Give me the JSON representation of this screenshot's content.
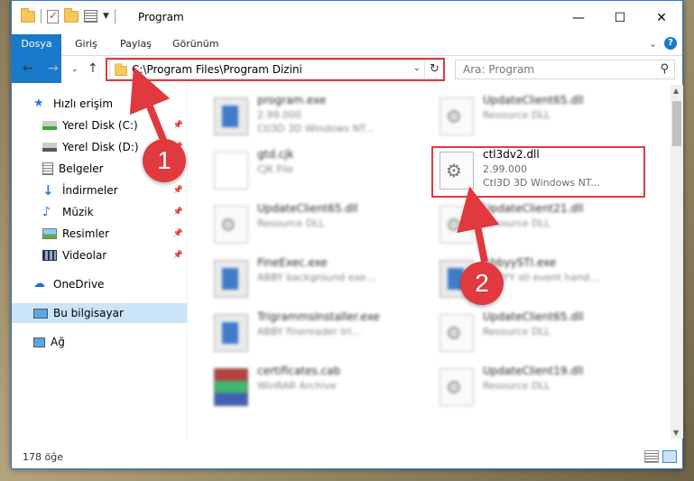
{
  "window": {
    "title": "Program",
    "controls": {
      "minimize": "—",
      "maximize": "☐",
      "close": "✕"
    }
  },
  "ribbon": {
    "tabs": [
      "Dosya",
      "Giriş",
      "Paylaş",
      "Görünüm"
    ],
    "help": "?"
  },
  "nav": {
    "address": "C:\\Program Files\\Program Dizini",
    "search_placeholder": "Ara: Program"
  },
  "sidebar": {
    "items": [
      {
        "label": "Hızlı erişim",
        "icon": "star-icon"
      },
      {
        "label": "Yerel Disk (C:)",
        "icon": "drive-icon"
      },
      {
        "label": "Yerel Disk (D:)",
        "icon": "drive-icon"
      },
      {
        "label": "Belgeler",
        "icon": "documents-icon"
      },
      {
        "label": "İndirmeler",
        "icon": "download-icon"
      },
      {
        "label": "Müzik",
        "icon": "music-icon"
      },
      {
        "label": "Resimler",
        "icon": "pictures-icon"
      },
      {
        "label": "Videolar",
        "icon": "video-icon"
      },
      {
        "label": "OneDrive",
        "icon": "cloud-icon"
      },
      {
        "label": "Bu bilgisayar",
        "icon": "computer-icon"
      },
      {
        "label": "Ağ",
        "icon": "network-icon"
      }
    ]
  },
  "files": [
    {
      "name": "program.exe",
      "line2": "2.99.000",
      "line3": "Ctl3D 3D Windows NT...",
      "icon": "app-icon"
    },
    {
      "name": "UpdateClient65.dll",
      "line2": "Resource DLL",
      "line3": "",
      "icon": "gear-doc-icon"
    },
    {
      "name": "gtd.cjk",
      "line2": "CJK File",
      "line3": "",
      "icon": "doc-icon"
    },
    {
      "name": "ctl3dv2.dll",
      "line2": "2.99.000",
      "line3": "Ctl3D 3D Windows NT...",
      "icon": "gear-doc-icon"
    },
    {
      "name": "UpdateClient65.dll",
      "line2": "Resource DLL",
      "line3": "",
      "icon": "gear-doc-icon"
    },
    {
      "name": "UpdateClient21.dll",
      "line2": "Resource DLL",
      "line3": "",
      "icon": "gear-doc-icon"
    },
    {
      "name": "FineExec.exe",
      "line2": "ABBY background exe...",
      "line3": "",
      "icon": "app-icon"
    },
    {
      "name": "AbbyySTI.exe",
      "line2": "ABBYY sti event hand...",
      "line3": "",
      "icon": "app-icon"
    },
    {
      "name": "TrigrammsInstaller.exe",
      "line2": "ABBY finereader tri...",
      "line3": "",
      "icon": "app-icon"
    },
    {
      "name": "UpdateClient65.dll",
      "line2": "Resource DLL",
      "line3": "",
      "icon": "gear-doc-icon"
    },
    {
      "name": "certificates.cab",
      "line2": "WinRAR Archive",
      "line3": "",
      "icon": "rar-icon"
    },
    {
      "name": "UpdateClient19.dll",
      "line2": "Resource DLL",
      "line3": "",
      "icon": "gear-doc-icon"
    }
  ],
  "status": {
    "count": "178 öğe"
  },
  "annotations": {
    "step1": "1",
    "step2": "2",
    "color": "#e0393e"
  }
}
